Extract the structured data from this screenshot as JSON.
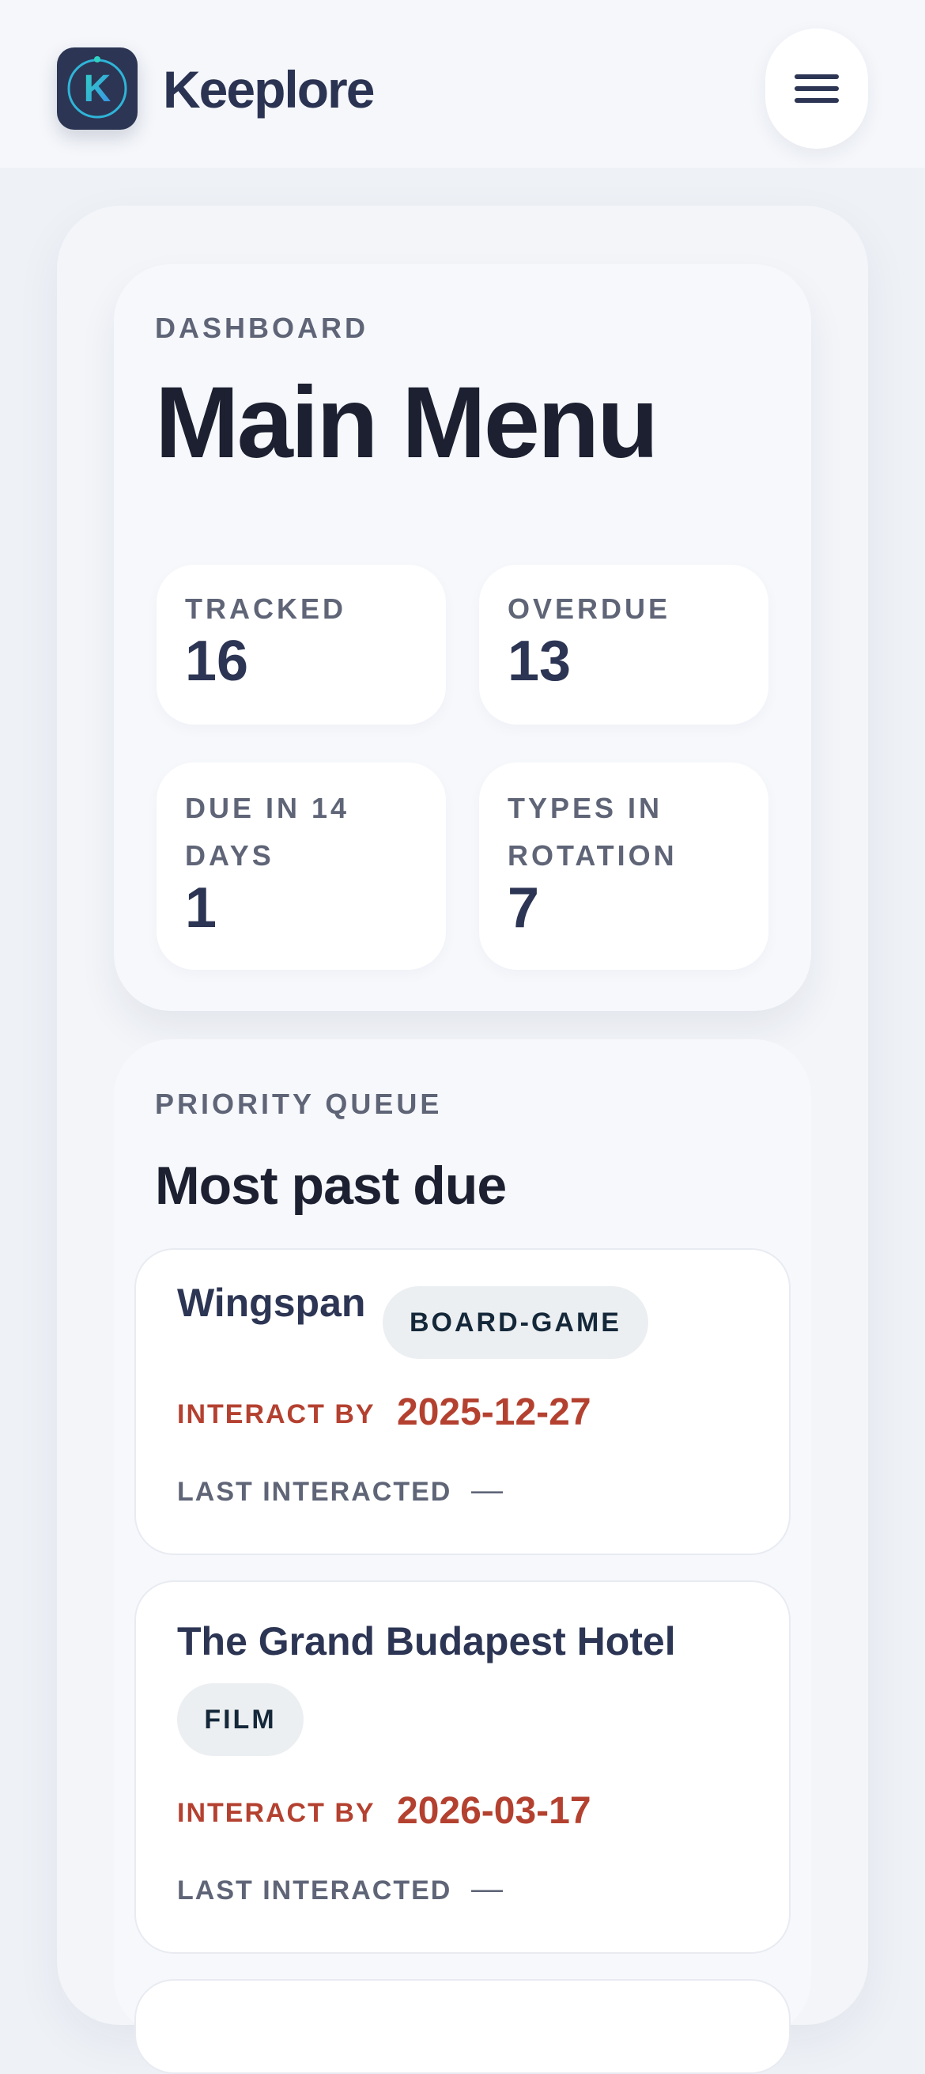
{
  "app": {
    "brand": "Keeplore",
    "logo_letter": "K",
    "menu_icon": "hamburger-icon"
  },
  "dashboard": {
    "eyebrow": "DASHBOARD",
    "title": "Main Menu",
    "stats": [
      {
        "label": "TRACKED",
        "value": "16"
      },
      {
        "label": "OVERDUE",
        "value": "13"
      },
      {
        "label": "DUE IN 14 DAYS",
        "value": "1"
      },
      {
        "label": "TYPES IN ROTATION",
        "value": "7"
      }
    ]
  },
  "queue": {
    "eyebrow": "PRIORITY QUEUE",
    "title": "Most past due",
    "items": [
      {
        "name": "Wingspan",
        "tag": "BOARD-GAME",
        "due_label": "INTERACT BY",
        "due_date": "2025-12-27",
        "last_label": "LAST INTERACTED",
        "last_value": "—"
      },
      {
        "name": "The Grand Budapest Hotel",
        "tag": "FILM",
        "due_label": "INTERACT BY",
        "due_date": "2026-03-17",
        "last_label": "LAST INTERACTED",
        "last_value": "—"
      }
    ]
  },
  "colors": {
    "accent_navy": "#2c3553",
    "overdue_red": "#b44130",
    "logo_gradient_start": "#2fd3c3",
    "logo_gradient_end": "#3a8fe8"
  }
}
